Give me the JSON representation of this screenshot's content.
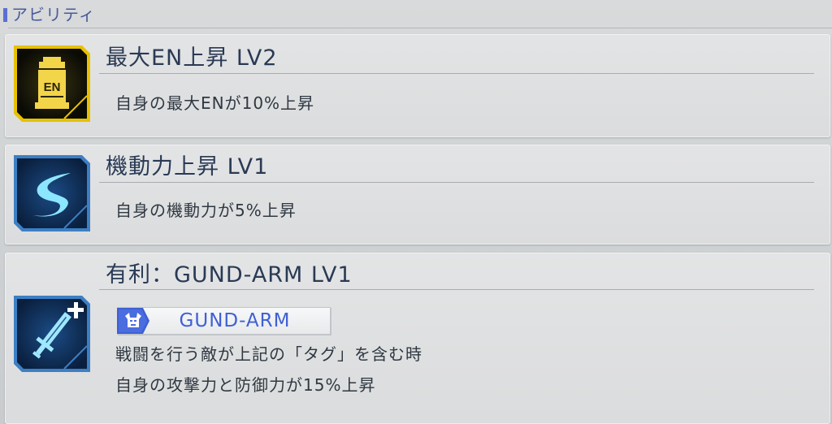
{
  "section": {
    "title": "アビリティ"
  },
  "abilities": [
    {
      "name": "最大EN上昇 LV2",
      "icon": "en-icon",
      "icon_text": "EN",
      "description_lines": [
        "自身の最大ENが10%上昇"
      ]
    },
    {
      "name": "機動力上昇 LV1",
      "icon": "mobility-icon",
      "description_lines": [
        "自身の機動力が5%上昇"
      ]
    },
    {
      "name": "有利：GUND-ARM LV1",
      "icon": "sword-plus-icon",
      "tag": {
        "label": "GUND-ARM",
        "icon": "gundam-head-icon"
      },
      "description_lines": [
        "戦闘を行う敵が上記の「タグ」を含む時",
        "自身の攻撃力と防御力が15%上昇"
      ]
    }
  ],
  "colors": {
    "accent_blue": "#3f60d4",
    "gold": "#e6c200",
    "cyan": "#7fe3ff",
    "dark_text": "#2a3a55"
  }
}
